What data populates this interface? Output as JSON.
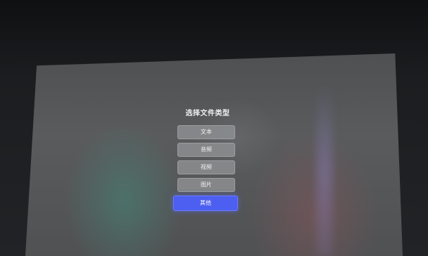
{
  "dialog": {
    "title": "选择文件类型",
    "options": [
      {
        "label": "文本"
      },
      {
        "label": "音频"
      },
      {
        "label": "视频"
      },
      {
        "label": "图片"
      },
      {
        "label": "其他"
      }
    ]
  },
  "colors": {
    "primary_button": "#4d5ff0",
    "secondary_button": "#8c8e90"
  }
}
